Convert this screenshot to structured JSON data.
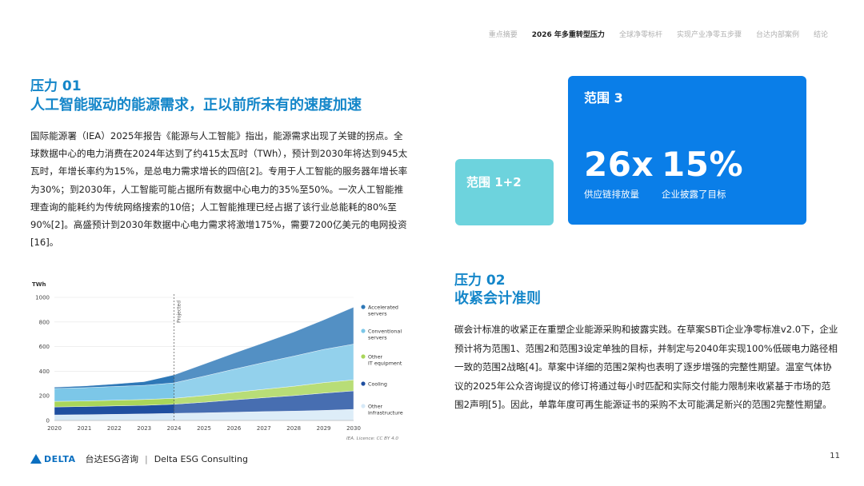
{
  "nav": {
    "items": [
      "重点摘要",
      "2026 年多重转型压力",
      "全球净零标杆",
      "实现产业净零五步骤",
      "台达内部案例",
      "结论"
    ],
    "active_index": 1
  },
  "pressure1": {
    "label": "压力 01",
    "title": "人工智能驱动的能源需求，正以前所未有的速度加速",
    "body": "国际能源署（IEA）2025年报告《能源与人工智能》指出，能源需求出现了关键的拐点。全球数据中心的电力消费在2024年达到了约415太瓦时（TWh），预计到2030年将达到945太瓦时，年增长率约为15%，是总电力需求增长的四倍[2]。专用于人工智能的服务器年增长率为30%；到2030年，人工智能可能占据所有数据中心电力的35%至50%。一次人工智能推理查询的能耗约为传统网络搜索的10倍；人工智能推理已经占据了该行业总能耗的80%至90%[2]。高盛预计到2030年数据中心电力需求将激增175%，需要7200亿美元的电网投资[16]。"
  },
  "scope_big": {
    "title": "范围 3",
    "stat1_value": "26x",
    "stat1_caption": "供应链排放量",
    "stat2_value": "15%",
    "stat2_caption": "企业披露了目标"
  },
  "scope_small": {
    "title": "范围 1+2"
  },
  "pressure2": {
    "label": "压力 02",
    "title": "收紧会计准则",
    "body": "碳会计标准的收紧正在重塑企业能源采购和披露实践。在草案SBTi企业净零标准v2.0下，企业预计将为范围1、范围2和范围3设定单独的目标，并制定与2040年实现100%低碳电力路径相一致的范围2战略[4]。草案中详细的范围2架构也表明了逐步增强的完整性期望。温室气体协议的2025年公众咨询提议的修订将通过每小时匹配和实际交付能力限制来收紧基于市场的范围2声明[5]。因此，单靠年度可再生能源证书的采购不太可能满足新兴的范围2完整性期望。"
  },
  "chart_data": {
    "type": "area",
    "ylabel": "TWh",
    "ylim": [
      0,
      1000
    ],
    "yticks": [
      0,
      200,
      400,
      600,
      800,
      1000
    ],
    "x": [
      2020,
      2021,
      2022,
      2023,
      2024,
      2025,
      2026,
      2027,
      2028,
      2029,
      2030
    ],
    "projected_from": 2024,
    "projected_label": "Projected",
    "source": "IEA. Licence: CC BY 4.0",
    "series": [
      {
        "name": "Other infrastructure",
        "color": "#d6e9f7",
        "values": [
          45,
          47,
          50,
          53,
          58,
          62,
          67,
          72,
          76,
          82,
          90
        ]
      },
      {
        "name": "Cooling",
        "color": "#1f4fa0",
        "values": [
          65,
          66,
          68,
          70,
          74,
          86,
          100,
          113,
          126,
          140,
          150
        ]
      },
      {
        "name": "Other IT equipment",
        "color": "#a9d65a",
        "values": [
          45,
          45,
          46,
          47,
          48,
          54,
          61,
          68,
          76,
          85,
          90
        ]
      },
      {
        "name": "Conventional servers",
        "color": "#7cc7e8",
        "values": [
          105,
          108,
          112,
          115,
          125,
          158,
          188,
          218,
          245,
          270,
          290
        ]
      },
      {
        "name": "Accelerated servers",
        "color": "#2e78b7",
        "values": [
          10,
          14,
          20,
          30,
          65,
          98,
          130,
          160,
          195,
          240,
          300
        ]
      }
    ]
  },
  "footer": {
    "logo_text": "DELTA",
    "brand_cn": "台达ESG咨询",
    "separator": "|",
    "brand_en": "Delta ESG Consulting",
    "page_number": "11"
  }
}
